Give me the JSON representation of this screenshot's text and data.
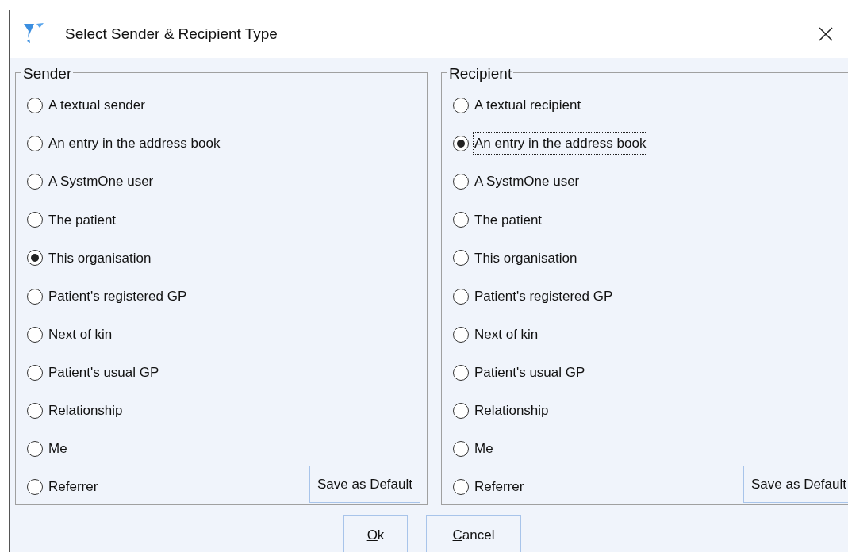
{
  "window": {
    "title": "Select Sender & Recipient Type"
  },
  "groups": [
    {
      "title": "Sender",
      "save_button": "Save as Default",
      "options": [
        {
          "label": "A textual sender",
          "selected": false,
          "focused": false
        },
        {
          "label": "An entry in the address book",
          "selected": false,
          "focused": false
        },
        {
          "label": "A SystmOne user",
          "selected": false,
          "focused": false
        },
        {
          "label": "The patient",
          "selected": false,
          "focused": false
        },
        {
          "label": "This organisation",
          "selected": true,
          "focused": false
        },
        {
          "label": "Patient's registered GP",
          "selected": false,
          "focused": false
        },
        {
          "label": "Next of kin",
          "selected": false,
          "focused": false
        },
        {
          "label": "Patient's usual GP",
          "selected": false,
          "focused": false
        },
        {
          "label": "Relationship",
          "selected": false,
          "focused": false
        },
        {
          "label": "Me",
          "selected": false,
          "focused": false
        },
        {
          "label": "Referrer",
          "selected": false,
          "focused": false
        }
      ]
    },
    {
      "title": "Recipient",
      "save_button": "Save as Default",
      "options": [
        {
          "label": "A textual recipient",
          "selected": false,
          "focused": false
        },
        {
          "label": "An entry in the address book",
          "selected": true,
          "focused": true
        },
        {
          "label": "A SystmOne user",
          "selected": false,
          "focused": false
        },
        {
          "label": "The patient",
          "selected": false,
          "focused": false
        },
        {
          "label": "This organisation",
          "selected": false,
          "focused": false
        },
        {
          "label": "Patient's registered GP",
          "selected": false,
          "focused": false
        },
        {
          "label": "Next of kin",
          "selected": false,
          "focused": false
        },
        {
          "label": "Patient's usual GP",
          "selected": false,
          "focused": false
        },
        {
          "label": "Relationship",
          "selected": false,
          "focused": false
        },
        {
          "label": "Me",
          "selected": false,
          "focused": false
        },
        {
          "label": "Referrer",
          "selected": false,
          "focused": false
        }
      ]
    }
  ],
  "buttons": [
    {
      "label": "Ok"
    },
    {
      "label": "Cancel"
    }
  ]
}
